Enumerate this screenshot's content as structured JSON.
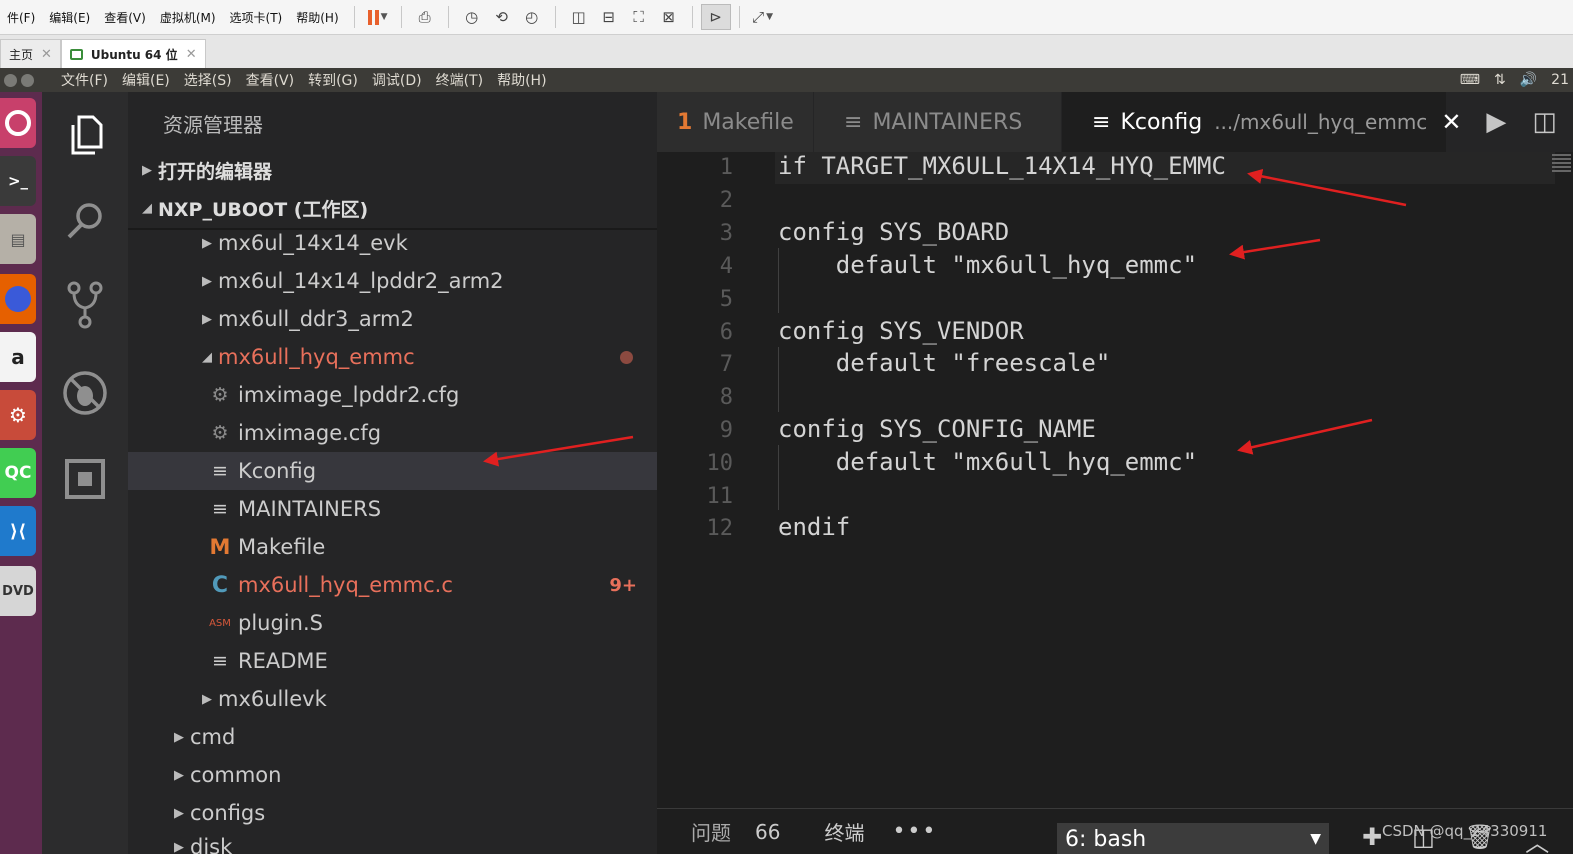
{
  "vmware": {
    "menu": [
      "件(F)",
      "编辑(E)",
      "查看(V)",
      "虚拟机(M)",
      "选项卡(T)",
      "帮助(H)"
    ],
    "tabs": [
      {
        "label": "主页",
        "close": "✕"
      },
      {
        "label": "Ubuntu 64 位",
        "close": "✕"
      }
    ]
  },
  "ubuntu": {
    "app_menu": [
      "文件(F)",
      "编辑(E)",
      "选择(S)",
      "查看(V)",
      "转到(G)",
      "调试(D)",
      "终端(T)",
      "帮助(H)"
    ],
    "clock": "21"
  },
  "explorer": {
    "title": "资源管理器",
    "sections": {
      "open_editors": "打开的编辑器",
      "workspace": "NXP_UBOOT (工作区)"
    },
    "tree": [
      {
        "label": "mx6ul_14x14_evk"
      },
      {
        "label": "mx6ul_14x14_lpddr2_arm2"
      },
      {
        "label": "mx6ull_ddr3_arm2"
      },
      {
        "label": "mx6ull_hyq_emmc"
      },
      {
        "label": "imximage_lpddr2.cfg"
      },
      {
        "label": "imximage.cfg"
      },
      {
        "label": "Kconfig"
      },
      {
        "label": "MAINTAINERS"
      },
      {
        "label": "Makefile",
        "icon_letter": "M"
      },
      {
        "label": "mx6ull_hyq_emmc.c",
        "icon_letter": "C",
        "badge": "9+"
      },
      {
        "label": "plugin.S",
        "icon_letter": "ASM"
      },
      {
        "label": "README"
      },
      {
        "label": "mx6ullevk"
      },
      {
        "label": "cmd"
      },
      {
        "label": "common"
      },
      {
        "label": "configs"
      },
      {
        "label": "disk"
      }
    ]
  },
  "editor": {
    "tabs": [
      {
        "label": "Makefile",
        "icon": "1"
      },
      {
        "label": "MAINTAINERS"
      },
      {
        "label": "Kconfig",
        "description": ".../mx6ull_hyq_emmc",
        "close": "✕"
      }
    ],
    "lines": [
      {
        "n": "1",
        "text": "if TARGET_MX6ULL_14X14_HYQ_EMMC"
      },
      {
        "n": "2",
        "text": ""
      },
      {
        "n": "3",
        "text": "config SYS_BOARD"
      },
      {
        "n": "4",
        "text": "    default \"mx6ull_hyq_emmc\""
      },
      {
        "n": "5",
        "text": ""
      },
      {
        "n": "6",
        "text": "config SYS_VENDOR"
      },
      {
        "n": "7",
        "text": "    default \"freescale\""
      },
      {
        "n": "8",
        "text": ""
      },
      {
        "n": "9",
        "text": "config SYS_CONFIG_NAME"
      },
      {
        "n": "10",
        "text": "    default \"mx6ull_hyq_emmc\""
      },
      {
        "n": "11",
        "text": ""
      },
      {
        "n": "12",
        "text": "endif"
      }
    ]
  },
  "panel": {
    "problems_label": "问题",
    "problems_count": "66",
    "terminal_label": "终端",
    "more": "•••",
    "terminal_select": "6: bash"
  },
  "watermark": "CSDN @qq_24330911",
  "colors": {
    "arrow": "#e02020",
    "modified": "#e8705b",
    "launcher": "#5d2b4e"
  }
}
